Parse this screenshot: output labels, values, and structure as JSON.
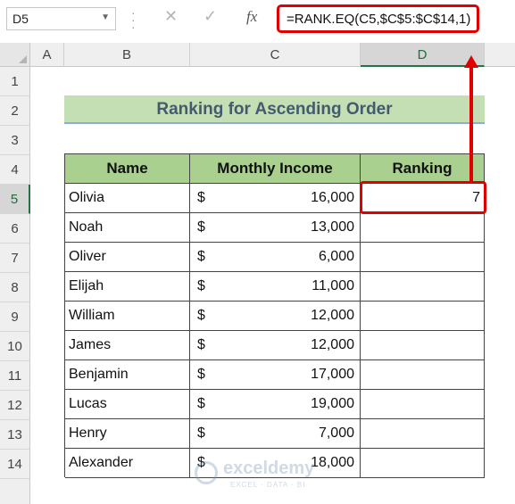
{
  "formula_bar": {
    "name_box": "D5",
    "formula": "=RANK.EQ(C5,$C$5:$C$14,1)",
    "cancel_glyph": "✕",
    "enter_glyph": "✓",
    "fx_label": "fx"
  },
  "columns": [
    "A",
    "B",
    "C",
    "D"
  ],
  "active_column": "D",
  "rows": [
    "1",
    "2",
    "3",
    "4",
    "5",
    "6",
    "7",
    "8",
    "9",
    "10",
    "11",
    "12",
    "13",
    "14"
  ],
  "active_row": "5",
  "title": "Ranking for Ascending Order",
  "table": {
    "headers": [
      "Name",
      "Monthly Income",
      "Ranking"
    ],
    "currency_symbol": "$",
    "rows": [
      {
        "name": "Olivia",
        "income": "16,000",
        "ranking": "7"
      },
      {
        "name": "Noah",
        "income": "13,000",
        "ranking": ""
      },
      {
        "name": "Oliver",
        "income": "6,000",
        "ranking": ""
      },
      {
        "name": "Elijah",
        "income": "11,000",
        "ranking": ""
      },
      {
        "name": "William",
        "income": "12,000",
        "ranking": ""
      },
      {
        "name": "James",
        "income": "12,000",
        "ranking": ""
      },
      {
        "name": "Benjamin",
        "income": "17,000",
        "ranking": ""
      },
      {
        "name": "Lucas",
        "income": "19,000",
        "ranking": ""
      },
      {
        "name": "Henry",
        "income": "7,000",
        "ranking": ""
      },
      {
        "name": "Alexander",
        "income": "18,000",
        "ranking": ""
      }
    ]
  },
  "watermark": {
    "brand": "exceldemy",
    "tagline": "EXCEL · DATA · BI"
  },
  "colors": {
    "accent_red": "#e00000",
    "header_green": "#a9d08e",
    "title_green": "#c5dfb4",
    "excel_green": "#217346"
  }
}
